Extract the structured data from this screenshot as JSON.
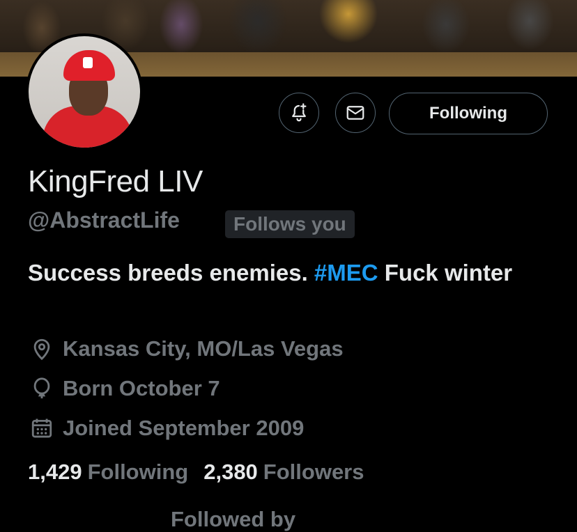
{
  "profile": {
    "display_name": "KingFred LIV",
    "handle": "@AbstractLife",
    "follows_you_badge": "Follows you",
    "bio": {
      "text_before": "Success breeds enemies. ",
      "hashtag": "#MEC",
      "text_after": " Fuck winter"
    },
    "location": "Kansas City, MO/Las Vegas",
    "birthday": "Born October 7",
    "joined": "Joined September 2009"
  },
  "actions": {
    "notify_icon": "bell-plus-icon",
    "message_icon": "envelope-icon",
    "follow_label": "Following"
  },
  "stats": {
    "following_count": "1,429",
    "following_label": "Following",
    "followers_count": "2,380",
    "followers_label": "Followers"
  },
  "footer_cutoff": "Followed by",
  "colors": {
    "background": "#000000",
    "text_primary": "#e7e9ea",
    "text_secondary": "#71767b",
    "accent": "#1d9bf0",
    "border": "#536471"
  }
}
